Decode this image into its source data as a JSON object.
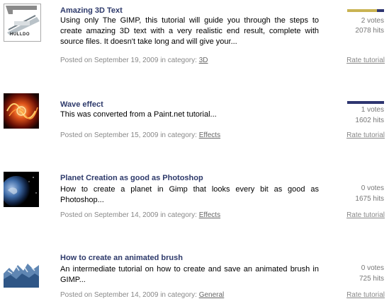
{
  "items": [
    {
      "thumb_icon": "hulldo-3d-text-thumbnail-icon",
      "thumb_caption": "HULLDO",
      "title": "Amazing 3D Text",
      "description": "Using only The GIMP, this tutorial will guide you through the steps to create amazing 3D text with a very realistic end result, complete with source files. It doesn't take long and will give your...",
      "posted_prefix": "Posted on September 19, 2009 in category: ",
      "category": "3D",
      "rating": 0.8,
      "votes": "2 votes",
      "hits": "2078 hits",
      "rate_label": "Rate tutorial"
    },
    {
      "thumb_icon": "wave-effect-thumbnail-icon",
      "title": "Wave effect",
      "description": "This was converted from a Paint.net tutorial...",
      "posted_prefix": "Posted on September 15, 2009 in category: ",
      "category": "Effects",
      "rating": 0.0,
      "votes": "1 votes",
      "hits": "1602 hits",
      "rate_label": "Rate tutorial"
    },
    {
      "thumb_icon": "planet-thumbnail-icon",
      "title": "Planet Creation as good as Photoshop",
      "description": "How to create a planet in Gimp that looks every bit as good as Photoshop...",
      "posted_prefix": "Posted on September 14, 2009 in category: ",
      "category": "Effects",
      "votes": "0 votes",
      "hits": "1675 hits",
      "rate_label": "Rate tutorial"
    },
    {
      "thumb_icon": "animated-brush-thumbnail-icon",
      "title": "How to create an animated brush",
      "description": "An intermediate tutorial on how to create and save an animated brush in GIMP...",
      "posted_prefix": "Posted on September 14, 2009 in category: ",
      "category": "General",
      "votes": "0 votes",
      "hits": "725 hits",
      "rate_label": "Rate tutorial"
    }
  ]
}
